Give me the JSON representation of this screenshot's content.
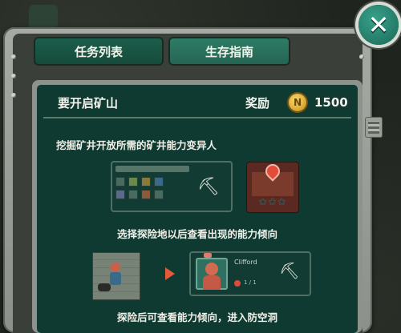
{
  "tabs": [
    {
      "label": "任务列表",
      "active": true
    },
    {
      "label": "生存指南",
      "active": false
    }
  ],
  "mission": {
    "title": "要开启矿山",
    "reward_label": "奖励",
    "reward_value": "1500",
    "coin_glyph": "N"
  },
  "guide": {
    "step1": "挖掘矿井开放所需的矿井能力变异人",
    "step2": "选择探险地以后查看出现的能力倾向",
    "step3": "探险后可查看能力倾向，进入防空洞"
  },
  "profile_card": {
    "name": "Clifford",
    "level_text": "1 / 1"
  },
  "map_card": {
    "stars": "★★★"
  },
  "icons": {
    "close": "close-icon",
    "coin": "coin-icon",
    "pickaxe": "pickaxe-icon",
    "map_pin": "map-pin-icon",
    "arrow": "arrow-right-icon"
  },
  "colors": {
    "accent_green": "#1d5f4c",
    "panel_bg": "#0f3a31",
    "coin_gold": "#e0b23a",
    "arrow_red": "#e25a3a"
  }
}
